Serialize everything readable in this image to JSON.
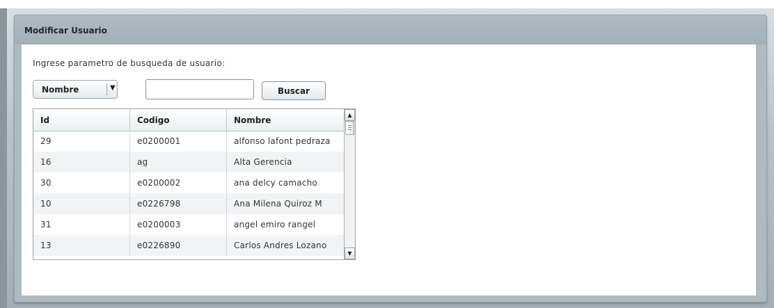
{
  "panel": {
    "title": "Modificar Usuario"
  },
  "search": {
    "prompt": "Ingrese parametro de busqueda de usuario:",
    "field_selected": "Nombre",
    "input_value": "",
    "button_label": "Buscar"
  },
  "grid": {
    "columns": [
      "Id",
      "Codigo",
      "Nombre"
    ],
    "rows": [
      [
        "29",
        "e0200001",
        "alfonso lafont pedraza"
      ],
      [
        "16",
        "ag",
        "Alta Gerencia"
      ],
      [
        "30",
        "e0200002",
        "ana delcy camacho"
      ],
      [
        "10",
        "e0226798",
        "Ana Milena Quiroz M"
      ],
      [
        "31",
        "e0200003",
        "angel emiro rangel"
      ],
      [
        "13",
        "e0226890",
        "Carlos Andres Lozano"
      ]
    ]
  },
  "icons": {
    "dropdown_arrow": "chevron-down-icon",
    "scroll_up": "arrow-up-icon",
    "scroll_down": "arrow-down-icon"
  },
  "colors": {
    "panel_bg": "#aebbc1",
    "alt_row": "#f1f3f4"
  }
}
